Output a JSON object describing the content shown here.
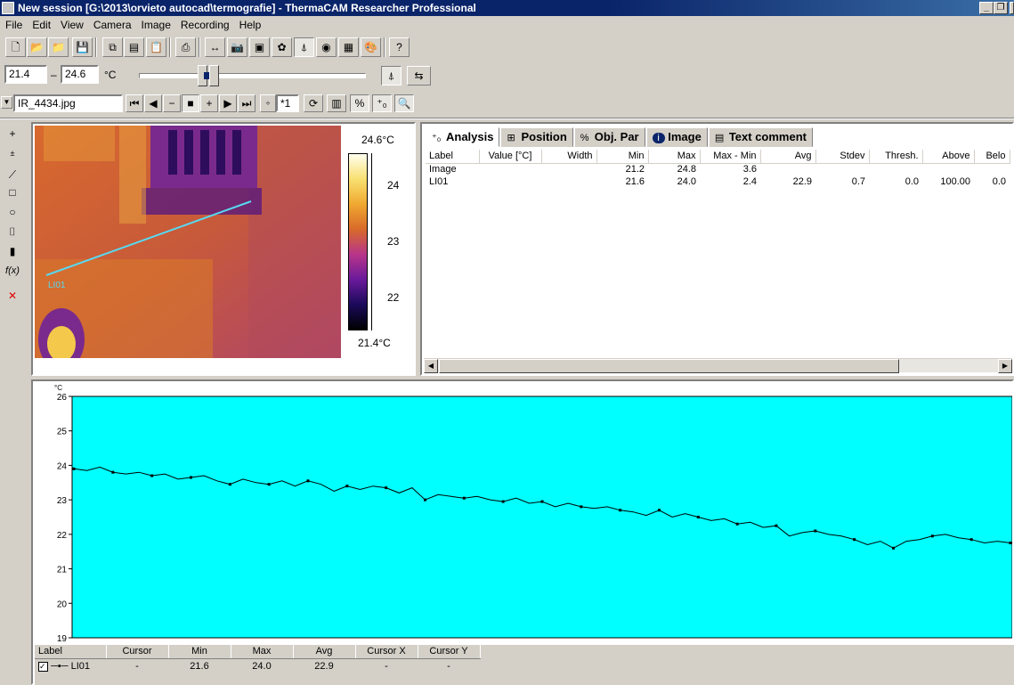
{
  "window": {
    "title": "New session [G:\\2013\\orvieto autocad\\termografie] - ThermaCAM Researcher Professional"
  },
  "menu": [
    "File",
    "Edit",
    "View",
    "Camera",
    "Image",
    "Recording",
    "Help"
  ],
  "range": {
    "min": "21.4",
    "dash": "–",
    "max": "24.6",
    "unit": "°C"
  },
  "file": {
    "name": "IR_4434.jpg",
    "zoom": "*1"
  },
  "image": {
    "scale_top": "24.6°C",
    "scale_bottom": "21.4°C",
    "scale_ticks": [
      "24",
      "23",
      "22"
    ],
    "line_label": "LI01"
  },
  "analysis": {
    "tabs": [
      "Analysis",
      "Position",
      "Obj. Par",
      "Image",
      "Text comment"
    ],
    "columns": [
      "Label",
      "Value [°C]",
      "Width",
      "Min",
      "Max",
      "Max - Min",
      "Avg",
      "Stdev",
      "Thresh.",
      "Above",
      "Belo"
    ],
    "rows": [
      [
        "Image",
        "",
        "",
        "21.2",
        "24.8",
        "3.6",
        "",
        "",
        "",
        "",
        ""
      ],
      [
        "LI01",
        "",
        "",
        "21.6",
        "24.0",
        "2.4",
        "22.9",
        "0.7",
        "0.0",
        "100.00",
        "0.0"
      ]
    ]
  },
  "profile": {
    "unit": "°C",
    "background": "#00ffff",
    "legend_columns": [
      "Label",
      "Cursor",
      "Min",
      "Max",
      "Avg",
      "Cursor X",
      "Cursor Y"
    ],
    "legend_row": [
      "LI01",
      "-",
      "21.6",
      "24.0",
      "22.9",
      "-",
      "-"
    ]
  },
  "chart_data": {
    "type": "line",
    "ylim": [
      19,
      26
    ],
    "yticks": [
      26,
      25,
      24,
      23,
      22,
      21,
      20,
      19
    ],
    "grid": false,
    "series": [
      {
        "name": "LI01",
        "x": [
          0,
          1,
          2,
          3,
          4,
          5,
          6,
          7,
          8,
          9,
          10,
          11,
          12,
          13,
          14,
          15,
          16,
          17,
          18,
          19,
          20,
          21,
          22,
          23,
          24,
          25,
          26,
          27,
          28,
          29,
          30,
          31,
          32,
          33,
          34,
          35,
          36,
          37,
          38,
          39,
          40,
          41,
          42,
          43,
          44,
          45,
          46,
          47,
          48,
          49,
          50,
          51,
          52,
          53,
          54,
          55,
          56,
          57,
          58,
          59,
          60,
          61,
          62,
          63,
          64,
          65,
          66,
          67,
          68,
          69,
          70,
          71,
          72
        ],
        "values": [
          23.9,
          23.85,
          23.95,
          23.8,
          23.75,
          23.8,
          23.7,
          23.75,
          23.6,
          23.65,
          23.7,
          23.55,
          23.45,
          23.6,
          23.5,
          23.45,
          23.55,
          23.4,
          23.55,
          23.45,
          23.25,
          23.4,
          23.3,
          23.4,
          23.35,
          23.2,
          23.35,
          23.0,
          23.15,
          23.1,
          23.05,
          23.1,
          23.0,
          22.95,
          23.05,
          22.9,
          22.95,
          22.8,
          22.9,
          22.8,
          22.75,
          22.8,
          22.7,
          22.65,
          22.55,
          22.7,
          22.5,
          22.6,
          22.5,
          22.4,
          22.45,
          22.3,
          22.35,
          22.2,
          22.25,
          21.95,
          22.05,
          22.1,
          22.0,
          21.95,
          21.85,
          21.7,
          21.8,
          21.6,
          21.8,
          21.85,
          21.95,
          22.0,
          21.9,
          21.85,
          21.75,
          21.8,
          21.75
        ]
      }
    ]
  }
}
